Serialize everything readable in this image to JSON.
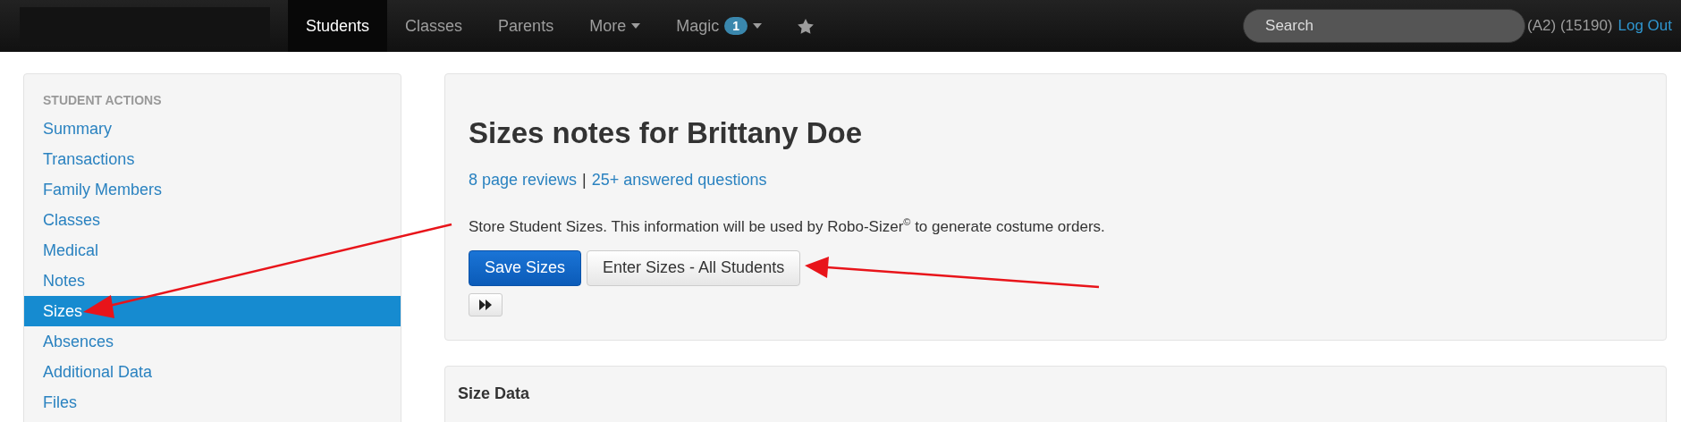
{
  "navbar": {
    "items": [
      {
        "label": "Students",
        "selected": true,
        "dropdown": false
      },
      {
        "label": "Classes",
        "selected": false,
        "dropdown": false
      },
      {
        "label": "Parents",
        "selected": false,
        "dropdown": false
      },
      {
        "label": "More",
        "selected": false,
        "dropdown": true
      },
      {
        "label": "Magic",
        "selected": false,
        "dropdown": true,
        "badge": "1"
      }
    ],
    "search": {
      "placeholder": "Search"
    },
    "user_info": "(A2) (15190)",
    "logout": "Log Out"
  },
  "sidebar": {
    "heading": "STUDENT ACTIONS",
    "items": [
      {
        "label": "Summary",
        "selected": false
      },
      {
        "label": "Transactions",
        "selected": false
      },
      {
        "label": "Family Members",
        "selected": false
      },
      {
        "label": "Classes",
        "selected": false
      },
      {
        "label": "Medical",
        "selected": false
      },
      {
        "label": "Notes",
        "selected": false
      },
      {
        "label": "Sizes",
        "selected": true
      },
      {
        "label": "Absences",
        "selected": false
      },
      {
        "label": "Additional Data",
        "selected": false
      },
      {
        "label": "Files",
        "selected": false
      }
    ]
  },
  "main": {
    "title": "Sizes notes for Brittany Doe",
    "links": [
      "8 page reviews",
      "25+ answered questions"
    ],
    "separator": "|",
    "description": "Store Student Sizes. This information will be used by Robo-Sizer$^{©}$ to generate costume orders.",
    "buttons": [
      {
        "label": "Save Sizes",
        "kind": "primary"
      },
      {
        "label": "Enter Sizes - All Students",
        "kind": "default"
      }
    ],
    "section_title": "Size Data"
  }
}
